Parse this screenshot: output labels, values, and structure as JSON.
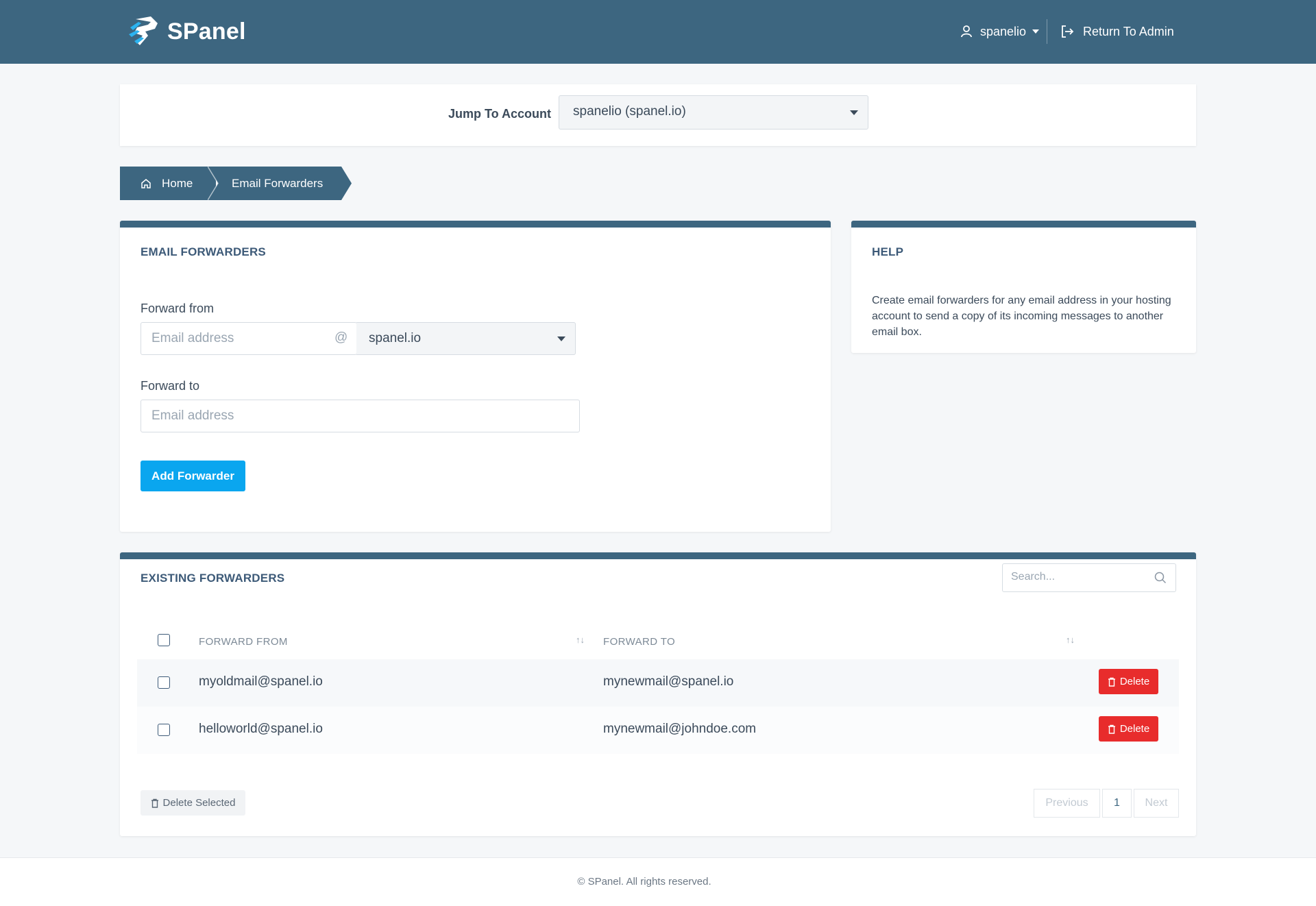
{
  "header": {
    "brand": "SPanel",
    "user": "spanelio",
    "return_admin": "Return To Admin"
  },
  "jump": {
    "label": "Jump To Account",
    "selected": "spanelio (spanel.io)"
  },
  "breadcrumb": {
    "home": "Home",
    "current": "Email Forwarders"
  },
  "forwarders_form": {
    "title": "EMAIL FORWARDERS",
    "forward_from_label": "Forward from",
    "forward_from_placeholder": "Email address",
    "at_symbol": "@",
    "domain_selected": "spanel.io",
    "forward_to_label": "Forward to",
    "forward_to_placeholder": "Email address",
    "add_button": "Add Forwarder"
  },
  "help": {
    "title": "HELP",
    "text": "Create email forwarders for any email address in your hosting account to send a copy of its incoming messages to another email box."
  },
  "existing": {
    "title": "EXISTING FORWARDERS",
    "search_placeholder": "Search...",
    "columns": [
      "FORWARD FROM",
      "FORWARD TO"
    ],
    "rows": [
      {
        "from": "myoldmail@spanel.io",
        "to": "mynewmail@spanel.io",
        "action": "Delete"
      },
      {
        "from": "helloworld@spanel.io",
        "to": "mynewmail@johndoe.com",
        "action": "Delete"
      }
    ],
    "delete_selected": "Delete Selected",
    "pagination": {
      "previous": "Previous",
      "page": "1",
      "next": "Next"
    }
  },
  "footer": {
    "copyright": "© SPanel. All rights reserved."
  }
}
